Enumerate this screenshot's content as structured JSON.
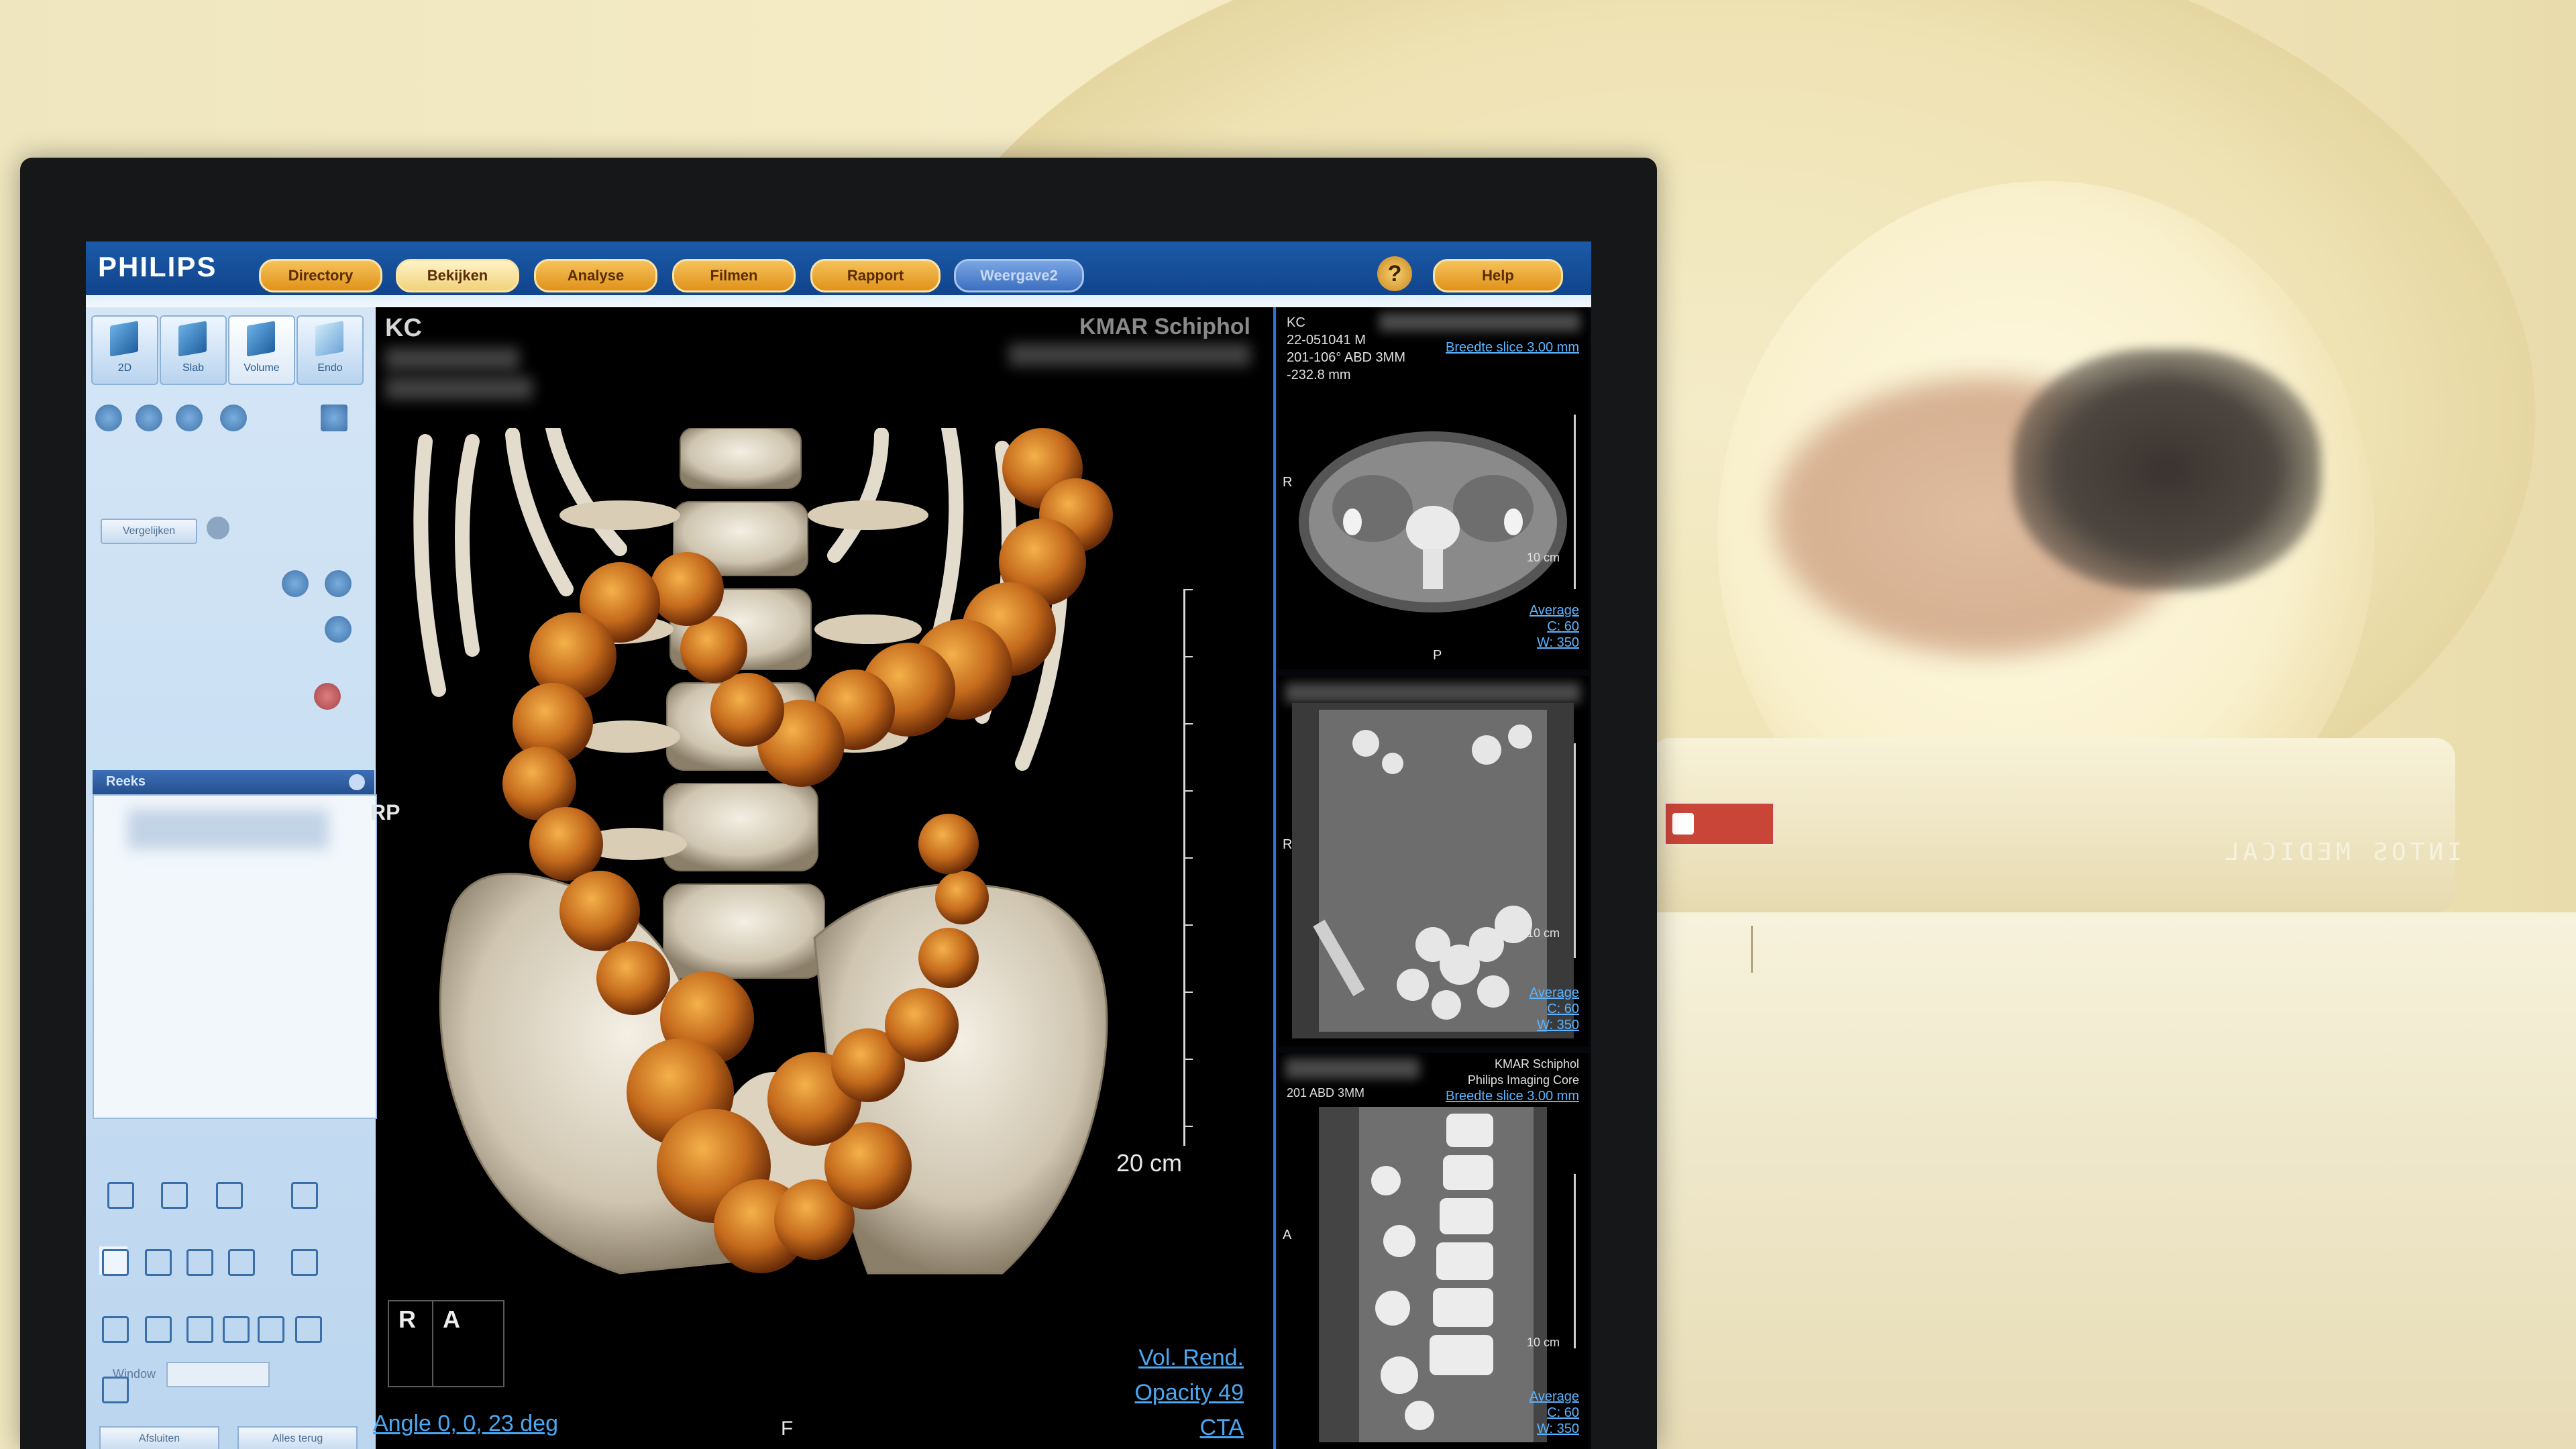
{
  "app": {
    "logo": "PHILIPS",
    "tabs": [
      "Directory",
      "Bekijken",
      "Analyse",
      "Filmen",
      "Rapport",
      "Weergave2"
    ],
    "help_icon": "?",
    "help_label": "Help"
  },
  "left_panel": {
    "modes": [
      {
        "label": "2D",
        "icon": "cube-icon"
      },
      {
        "label": "Slab",
        "icon": "slab-icon"
      },
      {
        "label": "Volume",
        "icon": "volume-icon"
      },
      {
        "label": "Endo",
        "icon": "endo-icon"
      }
    ],
    "compare_button": "Vergelijken",
    "series_header": "Reeks",
    "window_label": "Window",
    "bottom_buttons": [
      "Afsluiten",
      "Alles terug"
    ]
  },
  "viewport": {
    "patient_initials": "KC",
    "institution": "KMAR Schiphol",
    "label_right": "RP",
    "scale": "20 cm",
    "orientation_r": "R",
    "orientation_a": "A",
    "bottom_label": "F",
    "angle": "Angle 0, 0, 23 deg",
    "mode_lines": [
      "Vol. Rend.",
      "Opacity 49",
      "CTA"
    ]
  },
  "axial_panel": {
    "lines": [
      "KC",
      "22-051041 M",
      "201-106° ABD 3MM",
      "-232.8 mm"
    ],
    "slice_link": "Breedte slice 3.00 mm",
    "side_left": "R",
    "side_bottom": "P",
    "scale": "10 cm",
    "window": [
      "Average",
      "C: 60",
      "W: 350"
    ]
  },
  "coronal_panel": {
    "side_left": "R",
    "scale": "10 cm",
    "window": [
      "Average",
      "C: 60",
      "W: 350"
    ]
  },
  "sagittal_panel": {
    "lines": [
      "201 ABD 3MM"
    ],
    "header_right": [
      "KMAR Schiphol",
      "Philips Imaging Core",
      "Breedte slice 3.00 mm"
    ],
    "side_left": "A",
    "scale": "10 cm",
    "window": [
      "Average",
      "C: 60",
      "W: 350"
    ]
  },
  "background": {
    "scanner_brand": "INTOS MEDICAL"
  },
  "colors": {
    "topbar": "#1b5aa8",
    "tab": "#e8a632",
    "link_blue": "#4aa8f2",
    "panel_bg": "#cfe2f4"
  }
}
